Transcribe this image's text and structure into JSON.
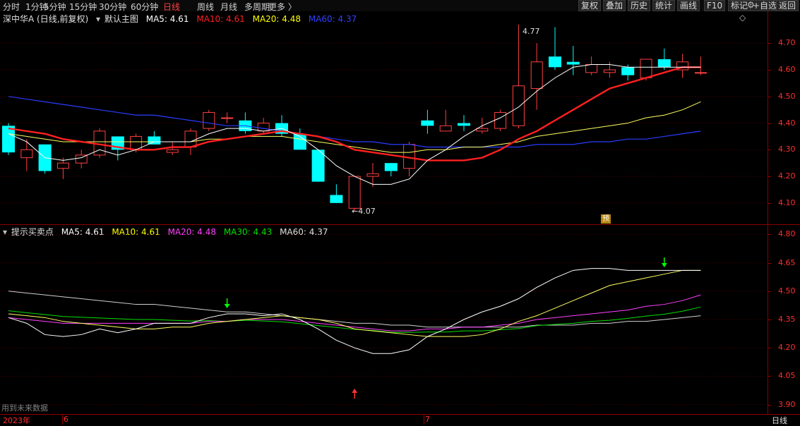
{
  "toolbar": {
    "periods": [
      "分时",
      "1分钟",
      "5分钟",
      "15分钟",
      "30分钟",
      "60分钟",
      "日线",
      "周线",
      "月线",
      "多周期",
      "更多 〉"
    ],
    "active_period": "日线",
    "right_buttons": [
      "复权",
      "叠加",
      "历史",
      "统计",
      "画线",
      "F10",
      "标记",
      "+自选",
      "返回"
    ],
    "icons": [
      "settings-icon",
      "window-restore-icon"
    ]
  },
  "main_legend": {
    "stock": "深中华A (日线,前复权)",
    "collapse_icon": "▾",
    "indicator": "默认主图",
    "ma5": "MA5: 4.61",
    "ma10": "MA10: 4.61",
    "ma20": "MA20: 4.48",
    "ma60": "MA60: 4.37",
    "corner_icon": "◇"
  },
  "sub_legend": {
    "collapse_icon": "▾",
    "indicator": "提示买卖点",
    "ma5": "MA5: 4.61",
    "ma10": "MA10: 4.61",
    "ma20": "MA20: 4.48",
    "ma30": "MA30: 4.43",
    "ma60": "MA60: 4.37"
  },
  "annotations": {
    "high": "4.77",
    "low": "←4.07",
    "pre_badge": "预",
    "future_data": "用到未来数据"
  },
  "footer": {
    "year": "2023年",
    "month1": "6",
    "month2": "7",
    "period": "日线"
  },
  "colors": {
    "up": "#ff4040",
    "down": "#00ffff",
    "ma5": "#ffffff",
    "ma10": "#ff2020",
    "ma20": "#ffff60",
    "ma60": "#2a3cff",
    "sub_ma20": "#ff40ff",
    "sub_ma30": "#00e000"
  },
  "chart_data": [
    {
      "type": "candlestick",
      "y_ticks": [
        "4.70",
        "4.60",
        "4.50",
        "4.40",
        "4.30",
        "4.20",
        "4.10"
      ],
      "ylim": [
        4.02,
        4.82
      ],
      "candles": [
        {
          "o": 4.39,
          "h": 4.4,
          "l": 4.28,
          "c": 4.29
        },
        {
          "o": 4.27,
          "h": 4.34,
          "l": 4.22,
          "c": 4.3
        },
        {
          "o": 4.32,
          "h": 4.32,
          "l": 4.21,
          "c": 4.22
        },
        {
          "o": 4.23,
          "h": 4.27,
          "l": 4.19,
          "c": 4.25
        },
        {
          "o": 4.25,
          "h": 4.3,
          "l": 4.23,
          "c": 4.28
        },
        {
          "o": 4.28,
          "h": 4.38,
          "l": 4.27,
          "c": 4.37
        },
        {
          "o": 4.35,
          "h": 4.35,
          "l": 4.26,
          "c": 4.3
        },
        {
          "o": 4.3,
          "h": 4.36,
          "l": 4.29,
          "c": 4.35
        },
        {
          "o": 4.35,
          "h": 4.37,
          "l": 4.32,
          "c": 4.32
        },
        {
          "o": 4.29,
          "h": 4.33,
          "l": 4.28,
          "c": 4.3
        },
        {
          "o": 4.31,
          "h": 4.38,
          "l": 4.28,
          "c": 4.37
        },
        {
          "o": 4.38,
          "h": 4.45,
          "l": 4.37,
          "c": 4.44
        },
        {
          "o": 4.42,
          "h": 4.44,
          "l": 4.4,
          "c": 4.42
        },
        {
          "o": 4.41,
          "h": 4.44,
          "l": 4.36,
          "c": 4.37
        },
        {
          "o": 4.37,
          "h": 4.42,
          "l": 4.36,
          "c": 4.4
        },
        {
          "o": 4.4,
          "h": 4.43,
          "l": 4.35,
          "c": 4.36
        },
        {
          "o": 4.36,
          "h": 4.38,
          "l": 4.3,
          "c": 4.3
        },
        {
          "o": 4.3,
          "h": 4.3,
          "l": 4.18,
          "c": 4.18
        },
        {
          "o": 4.13,
          "h": 4.17,
          "l": 4.1,
          "c": 4.1
        },
        {
          "o": 4.08,
          "h": 4.2,
          "l": 4.07,
          "c": 4.2
        },
        {
          "o": 4.2,
          "h": 4.25,
          "l": 4.16,
          "c": 4.21
        },
        {
          "o": 4.25,
          "h": 4.25,
          "l": 4.2,
          "c": 4.22
        },
        {
          "o": 4.23,
          "h": 4.33,
          "l": 4.2,
          "c": 4.32
        },
        {
          "o": 4.41,
          "h": 4.45,
          "l": 4.36,
          "c": 4.39
        },
        {
          "o": 4.37,
          "h": 4.45,
          "l": 4.37,
          "c": 4.39
        },
        {
          "o": 4.4,
          "h": 4.43,
          "l": 4.37,
          "c": 4.39
        },
        {
          "o": 4.37,
          "h": 4.42,
          "l": 4.36,
          "c": 4.38
        },
        {
          "o": 4.38,
          "h": 4.45,
          "l": 4.37,
          "c": 4.44
        },
        {
          "o": 4.39,
          "h": 4.77,
          "l": 4.38,
          "c": 4.54
        },
        {
          "o": 4.53,
          "h": 4.7,
          "l": 4.45,
          "c": 4.63
        },
        {
          "o": 4.65,
          "h": 4.76,
          "l": 4.6,
          "c": 4.61
        },
        {
          "o": 4.63,
          "h": 4.69,
          "l": 4.58,
          "c": 4.62
        },
        {
          "o": 4.59,
          "h": 4.65,
          "l": 4.58,
          "c": 4.62
        },
        {
          "o": 4.59,
          "h": 4.63,
          "l": 4.57,
          "c": 4.6
        },
        {
          "o": 4.61,
          "h": 4.62,
          "l": 4.56,
          "c": 4.58
        },
        {
          "o": 4.57,
          "h": 4.64,
          "l": 4.56,
          "c": 4.64
        },
        {
          "o": 4.64,
          "h": 4.68,
          "l": 4.6,
          "c": 4.61
        },
        {
          "o": 4.6,
          "h": 4.66,
          "l": 4.57,
          "c": 4.63
        },
        {
          "o": 4.59,
          "h": 4.65,
          "l": 4.58,
          "c": 4.59
        }
      ],
      "ma5": [
        4.36,
        4.33,
        4.27,
        4.26,
        4.27,
        4.3,
        4.28,
        4.3,
        4.33,
        4.33,
        4.33,
        4.36,
        4.38,
        4.38,
        4.37,
        4.38,
        4.35,
        4.3,
        4.24,
        4.2,
        4.17,
        4.17,
        4.19,
        4.26,
        4.3,
        4.35,
        4.39,
        4.42,
        4.46,
        4.52,
        4.57,
        4.61,
        4.62,
        4.62,
        4.61,
        4.61,
        4.61,
        4.61,
        4.61
      ],
      "ma10": [
        4.38,
        4.37,
        4.36,
        4.34,
        4.33,
        4.32,
        4.31,
        4.3,
        4.3,
        4.31,
        4.31,
        4.33,
        4.34,
        4.35,
        4.36,
        4.37,
        4.36,
        4.35,
        4.33,
        4.3,
        4.29,
        4.28,
        4.27,
        4.26,
        4.26,
        4.26,
        4.27,
        4.3,
        4.34,
        4.37,
        4.41,
        4.45,
        4.49,
        4.53,
        4.55,
        4.57,
        4.59,
        4.61,
        4.61
      ],
      "ma20": [
        4.36,
        4.35,
        4.34,
        4.33,
        4.33,
        4.33,
        4.33,
        4.33,
        4.33,
        4.33,
        4.33,
        4.34,
        4.34,
        4.35,
        4.35,
        4.35,
        4.34,
        4.33,
        4.32,
        4.31,
        4.3,
        4.29,
        4.29,
        4.3,
        4.3,
        4.31,
        4.31,
        4.32,
        4.33,
        4.35,
        4.36,
        4.37,
        4.38,
        4.39,
        4.4,
        4.42,
        4.43,
        4.45,
        4.48
      ],
      "ma60": [
        4.5,
        4.49,
        4.48,
        4.47,
        4.46,
        4.45,
        4.44,
        4.43,
        4.43,
        4.42,
        4.41,
        4.4,
        4.39,
        4.39,
        4.38,
        4.37,
        4.36,
        4.35,
        4.34,
        4.33,
        4.33,
        4.32,
        4.32,
        4.31,
        4.31,
        4.31,
        4.31,
        4.31,
        4.31,
        4.32,
        4.32,
        4.32,
        4.33,
        4.33,
        4.34,
        4.34,
        4.35,
        4.36,
        4.37
      ]
    },
    {
      "type": "line",
      "y_ticks": [
        "4.80",
        "4.65",
        "4.50",
        "4.35",
        "4.20",
        "4.05",
        "3.90"
      ],
      "ylim": [
        3.85,
        4.85
      ],
      "signals": [
        {
          "type": "sell",
          "index": 12
        },
        {
          "type": "buy",
          "index": 19
        },
        {
          "type": "sell",
          "index": 36
        }
      ]
    }
  ]
}
